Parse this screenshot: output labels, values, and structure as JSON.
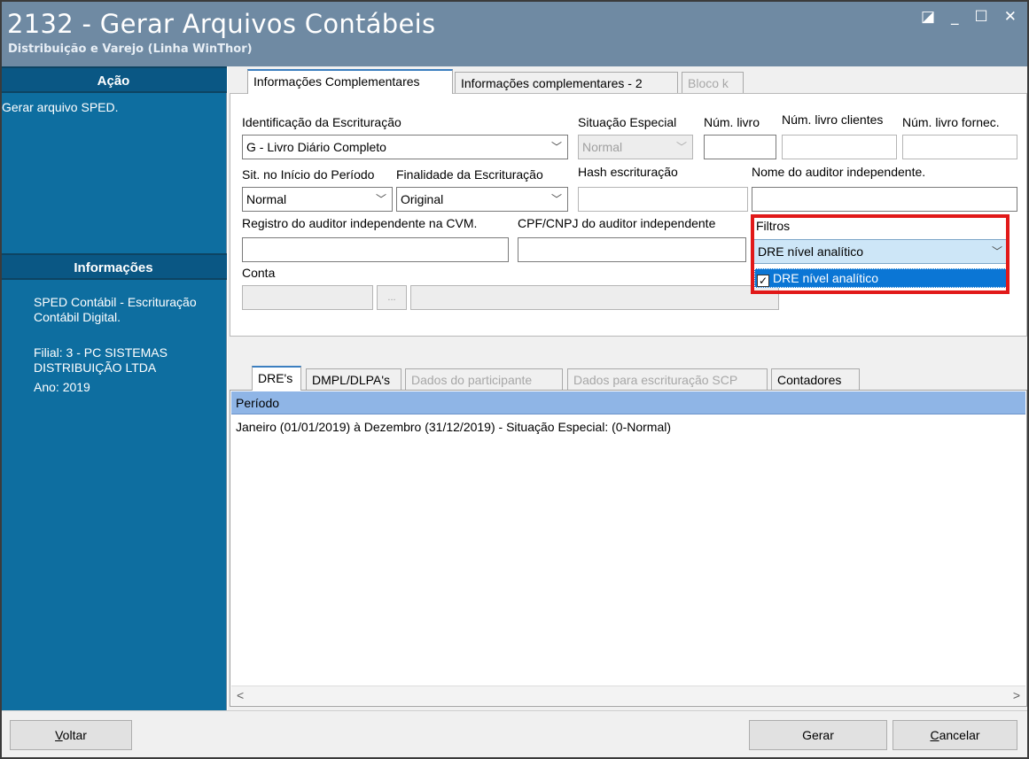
{
  "window": {
    "title": "2132 - Gerar Arquivos Contábeis",
    "subtitle": "Distribuição e Varejo (Linha WinThor)",
    "controls": {
      "restore": "◪",
      "minimize": "_",
      "maximize": "☐",
      "close": "✕"
    }
  },
  "sidebar": {
    "action_header": "Ação",
    "action_item": "Gerar arquivo SPED.",
    "info_header": "Informações",
    "info_description": "SPED Contábil - Escrituração Contábil Digital.",
    "info_filial": "Filial: 3 - PC SISTEMAS DISTRIBUIÇÃO LTDA",
    "info_ano": "Ano: 2019"
  },
  "top_tabs": [
    {
      "label": "Informações Complementares"
    },
    {
      "label": "Informações complementares - 2"
    },
    {
      "label": "Bloco k"
    }
  ],
  "form": {
    "identificacao_label": "Identificação da Escrituração",
    "identificacao_value": "G - Livro Diário Completo",
    "situacao_especial_label": "Situação Especial",
    "situacao_especial_value": "Normal",
    "num_livro_label": "Núm. livro",
    "num_livro_clientes_label": "Núm. livro clientes",
    "num_livro_fornec_label": "Núm. livro fornec.",
    "sit_inicio_label": "Sit. no Início do Período",
    "sit_inicio_value": "Normal",
    "finalidade_label": "Finalidade da Escrituração",
    "finalidade_value": "Original",
    "hash_label": "Hash escrituração",
    "nome_auditor_label": "Nome do auditor independente.",
    "registro_auditor_label": "Registro do auditor independente na CVM.",
    "cpf_auditor_label": "CPF/CNPJ do auditor independente",
    "conta_label": "Conta",
    "conta_button": "...",
    "filtros_label": "Filtros",
    "filtros_value": "DRE nível analítico",
    "filtros_option": "DRE nível analítico"
  },
  "bottom_tabs": [
    {
      "label": "DRE's"
    },
    {
      "label": "DMPL/DLPA's"
    },
    {
      "label": "Dados do participante"
    },
    {
      "label": "Dados para escrituração SCP"
    },
    {
      "label": "Contadores"
    }
  ],
  "grid": {
    "column": "Período",
    "rows": [
      "Janeiro (01/01/2019) à Dezembro (31/12/2019) - Situação Especial:  (0-Normal)"
    ]
  },
  "buttons": {
    "voltar_mnemonic": "V",
    "voltar_rest": "oltar",
    "gerar": "Gerar",
    "cancelar_mnemonic": "C",
    "cancelar_rest": "ancelar"
  },
  "colors": {
    "titlebar": "#6f8aa3",
    "sidebar": "#0e6ea0",
    "highlight": "#e11919",
    "selection": "#0b76d5"
  }
}
